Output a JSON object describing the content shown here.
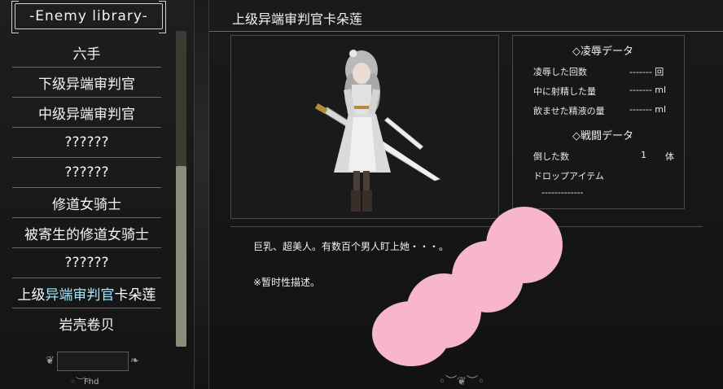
{
  "library": {
    "title": "-Enemy library-",
    "items": [
      {
        "label": "六手"
      },
      {
        "label": "下级异端审判官"
      },
      {
        "label": "中级异端审判官"
      },
      {
        "label": "??????"
      },
      {
        "label": "??????"
      },
      {
        "label": "修道女骑士"
      },
      {
        "label": "被寄生的修道女骑士"
      },
      {
        "label": "??????"
      },
      {
        "label_pre": "上级",
        "label_hl": "异端审判官",
        "label_post": "卡朵莲"
      },
      {
        "label": "岩壳卷贝"
      }
    ],
    "selected_index": 8,
    "scroll_fraction": 0.57
  },
  "enemy": {
    "name": "上级异端审判官卡朵莲"
  },
  "stats": {
    "ryoujoku_header": "◇凌辱データ",
    "ryoujoku_rows": [
      {
        "label": "凌辱した回数",
        "value": "------- 回"
      },
      {
        "label": "中に射精した量",
        "value": "------- ml"
      },
      {
        "label": "飲ませた精液の量",
        "value": "------- ml"
      }
    ],
    "sentou_header": "◇戦闘データ",
    "defeated_label": "倒した数",
    "defeated_value": "1",
    "defeated_unit": "体",
    "drop_label": "ドロップアイテム",
    "drop_value": "-------------"
  },
  "description": {
    "line1": "巨乳、超美人。有数百个男人盯上她・・・。",
    "line2": "※暂时性描述。"
  },
  "footer": {
    "left_text": "Fhd"
  },
  "colors": {
    "highlight": "#9ee8ff",
    "censor": "#f7b6cc"
  }
}
